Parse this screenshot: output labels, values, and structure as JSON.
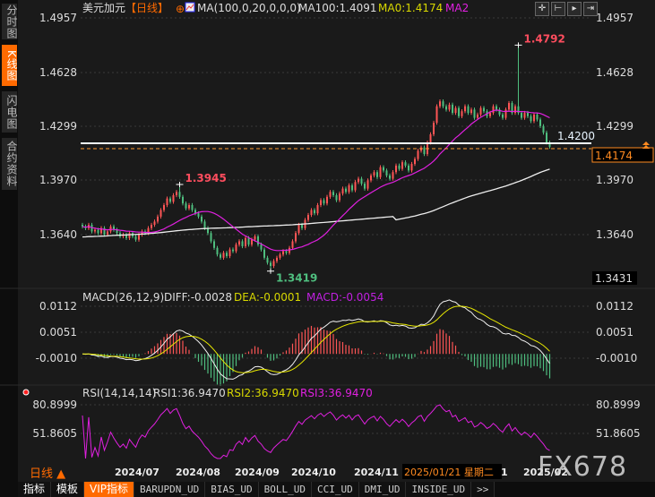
{
  "sidebar": {
    "tabs": [
      {
        "label": "分时图",
        "active": false
      },
      {
        "label": "K线图",
        "active": true
      },
      {
        "label": "闪电图",
        "active": false
      },
      {
        "label": "合约资料",
        "active": false
      }
    ]
  },
  "header": {
    "symbol": "美元加元",
    "period": "【日线】",
    "indicator": "MA(100,0,20,0,0,0)",
    "ma100": "MA100:1.4091",
    "ma0": "MA0:1.4174",
    "ma2": "MA2"
  },
  "toolbar_icons": [
    "crosshair-icon",
    "zoom-range-icon",
    "play-icon",
    "shift-right-icon"
  ],
  "colors": {
    "up": "#ff5555",
    "down": "#4fbf7f",
    "ma20": "#e020e0",
    "ma100": "#eeeeee",
    "accent": "#ff6a00",
    "dea": "#e8e800"
  },
  "chart_data": [
    {
      "type": "candlestick",
      "title": "美元加元 日线",
      "y_ticks": [
        "1.4957",
        "1.4628",
        "1.4299",
        "1.3970",
        "1.3640"
      ],
      "ylim": [
        1.338,
        1.504
      ],
      "x_ticks": [
        "2024/07",
        "2024/08",
        "2024/09",
        "2024/10",
        "2024/11",
        "2025/02"
      ],
      "closes": [
        1.369,
        1.368,
        1.37,
        1.366,
        1.367,
        1.365,
        1.368,
        1.364,
        1.366,
        1.369,
        1.367,
        1.365,
        1.363,
        1.364,
        1.362,
        1.365,
        1.363,
        1.361,
        1.364,
        1.366,
        1.365,
        1.368,
        1.37,
        1.372,
        1.375,
        1.379,
        1.382,
        1.386,
        1.384,
        1.388,
        1.39,
        1.387,
        1.383,
        1.38,
        1.382,
        1.379,
        1.377,
        1.375,
        1.372,
        1.368,
        1.365,
        1.36,
        1.356,
        1.352,
        1.35,
        1.353,
        1.351,
        1.355,
        1.354,
        1.358,
        1.36,
        1.357,
        1.362,
        1.358,
        1.361,
        1.363,
        1.358,
        1.355,
        1.35,
        1.347,
        1.345,
        1.348,
        1.35,
        1.352,
        1.354,
        1.353,
        1.356,
        1.36,
        1.365,
        1.37,
        1.368,
        1.373,
        1.376,
        1.379,
        1.377,
        1.382,
        1.385,
        1.383,
        1.387,
        1.39,
        1.388,
        1.385,
        1.389,
        1.392,
        1.39,
        1.394,
        1.391,
        1.396,
        1.398,
        1.395,
        1.392,
        1.397,
        1.4,
        1.402,
        1.399,
        1.405,
        1.403,
        1.4,
        1.398,
        1.402,
        1.406,
        1.404,
        1.408,
        1.406,
        1.403,
        1.407,
        1.41,
        1.415,
        1.417,
        1.413,
        1.42,
        1.425,
        1.432,
        1.442,
        1.445,
        1.442,
        1.44,
        1.443,
        1.438,
        1.441,
        1.436,
        1.439,
        1.442,
        1.438,
        1.44,
        1.435,
        1.437,
        1.441,
        1.439,
        1.436,
        1.438,
        1.442,
        1.44,
        1.437,
        1.435,
        1.44,
        1.444,
        1.438,
        1.442,
        1.438,
        1.435,
        1.438,
        1.436,
        1.433,
        1.437,
        1.434,
        1.43,
        1.426,
        1.42,
        1.4174
      ],
      "annotations": [
        {
          "label": "1.4792",
          "index": 139,
          "price": 1.4792,
          "kind": "high"
        },
        {
          "label": "1.3945",
          "index": 31,
          "price": 1.3945,
          "kind": "high"
        },
        {
          "label": "1.3419",
          "index": 60,
          "price": 1.3419,
          "kind": "low"
        }
      ],
      "hline": {
        "label": "1.4200",
        "price": 1.42
      },
      "last_price": {
        "label": "1.4174",
        "price": 1.4174
      },
      "low_box": {
        "label": "1.3431"
      }
    },
    {
      "type": "macd",
      "title": "MACD(26,12,9)",
      "diff": "DIFF:-0.0028",
      "dea": "DEA:-0.0001",
      "macd": "MACD:-0.0054",
      "y_ticks": [
        "0.0112",
        "0.0051",
        "-0.0010"
      ]
    },
    {
      "type": "rsi",
      "title": "RSI(14,14,14)",
      "rsi1": "RSI1:36.9470",
      "rsi2": "RSI2:36.9470",
      "rsi3": "RSI3:36.9470",
      "y_ticks": [
        "80.8999",
        "51.8605"
      ]
    }
  ],
  "date_axis": {
    "period": "日线 ▲",
    "labels": [
      "2024/07",
      "2024/08",
      "2024/09",
      "2024/10",
      "2024/11"
    ],
    "cursor_date": "2025/01/21 星期二",
    "cursor_tail": "1",
    "last_label": "2025/02"
  },
  "bottom_tabs": [
    "指标",
    "模板",
    "VIP指标",
    "BARUPDN_UD",
    "BIAS_UD",
    "BOLL_UD",
    "CCI_UD",
    "DMI_UD",
    "INSIDE_UD",
    ">>"
  ],
  "watermark": "FX678"
}
